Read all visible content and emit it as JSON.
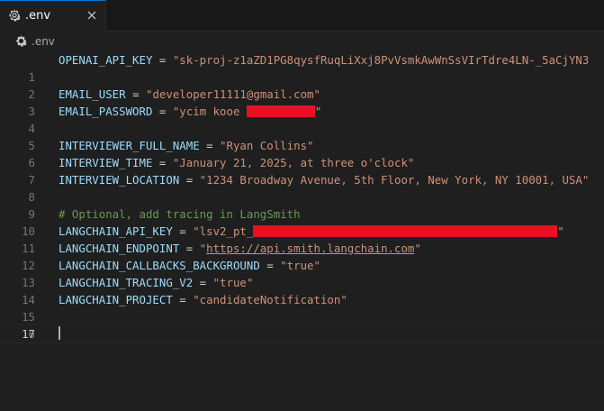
{
  "tab": {
    "label": ".env",
    "icon": "gear-icon",
    "close_icon": "close-icon"
  },
  "breadcrumb": {
    "label": ".env",
    "icon": "gear-icon"
  },
  "lines": [
    {
      "n": "1",
      "key": "OPENAI_API_KEY",
      "eq": " = ",
      "val": "\"sk-proj-z1aZD1PG8qysfRuqLiXxj8PvVsmkAwWnSsVIrTdre4LN-_5aCjYN3"
    },
    {
      "n": "2"
    },
    {
      "n": "3",
      "key": "EMAIL_USER",
      "eq": " = ",
      "val": "\"developer11111@gmail.com\""
    },
    {
      "n": "4",
      "key": "EMAIL_PASSWORD",
      "eq": " = ",
      "val": "\"ycim kooe ",
      "val_end": "\""
    },
    {
      "n": "5"
    },
    {
      "n": "6",
      "key": "INTERVIEWER_FULL_NAME",
      "eq": " = ",
      "val": "\"Ryan Collins\""
    },
    {
      "n": "7",
      "key": "INTERVIEW_TIME",
      "eq": " = ",
      "val": "\"January 21, 2025, at three o'clock\""
    },
    {
      "n": "8",
      "key": "INTERVIEW_LOCATION",
      "eq": " = ",
      "val": "\"1234 Broadway Avenue, 5th Floor, New York, NY 10001, USA\""
    },
    {
      "n": "9"
    },
    {
      "n": "10",
      "comment": "# Optional, add tracing in LangSmith"
    },
    {
      "n": "11",
      "key": "LANGCHAIN_API_KEY",
      "eq": " = ",
      "val": "\"lsv2_pt_",
      "val_end": "\""
    },
    {
      "n": "12",
      "key": "LANGCHAIN_ENDPOINT",
      "eq": " = ",
      "val_q": "\"",
      "val": "https://api.smith.langchain.com",
      "val_end": "\""
    },
    {
      "n": "13",
      "key": "LANGCHAIN_CALLBACKS_BACKGROUND",
      "eq": " = ",
      "val": "\"true\""
    },
    {
      "n": "14",
      "key": "LANGCHAIN_TRACING_V2",
      "eq": " = ",
      "val": "\"true\""
    },
    {
      "n": "15",
      "key": "LANGCHAIN_PROJECT",
      "eq": " = ",
      "val": "\"candidateNotification\""
    },
    {
      "n": "16"
    },
    {
      "n": "17"
    }
  ]
}
